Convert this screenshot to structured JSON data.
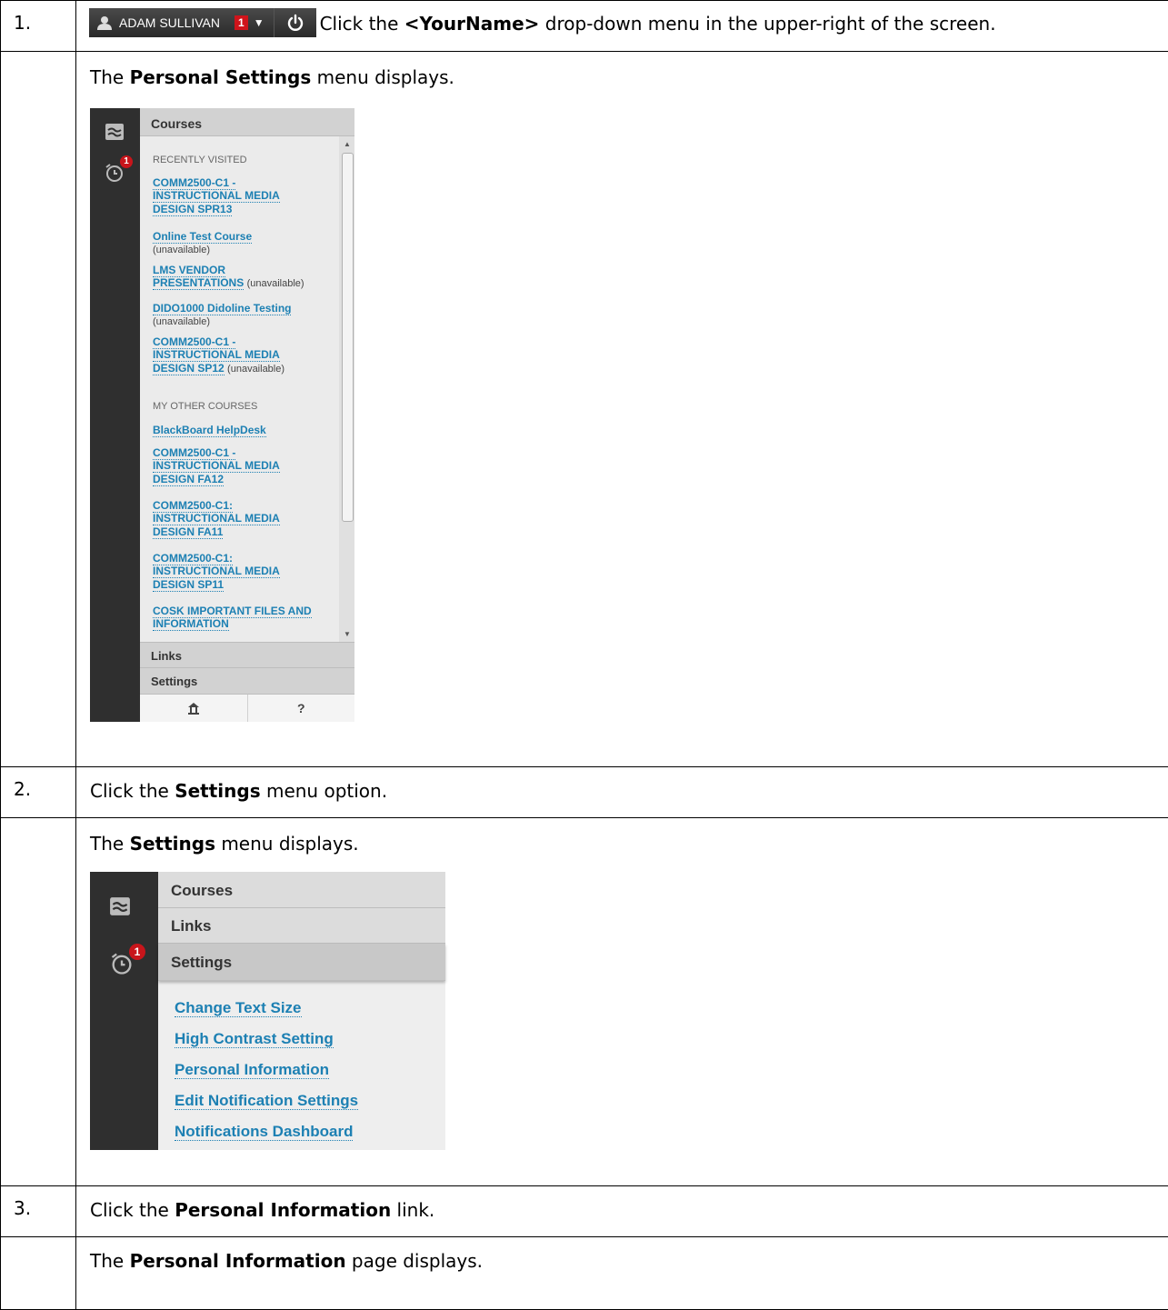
{
  "steps": [
    {
      "number": "1.",
      "instruction_pre": "Click the ",
      "instruction_bold": "<YourName>",
      "instruction_post": " drop-down menu in the upper-right of the screen.",
      "user_bar": {
        "user_name": "ADAM SULLIVAN",
        "notification_count": "1",
        "user_icon": "user-icon",
        "caret_icon": "caret-down-icon",
        "power_icon": "power-icon"
      }
    },
    {
      "result_pre": "The ",
      "result_bold": "Personal Settings",
      "result_post": " menu displays."
    },
    {
      "number": "2.",
      "instruction_pre": "Click the ",
      "instruction_bold": "Settings",
      "instruction_post": " menu option."
    },
    {
      "result_pre": "The ",
      "result_bold": "Settings",
      "result_post": " menu displays."
    },
    {
      "number": "3.",
      "instruction_pre": "Click the ",
      "instruction_bold": "Personal Information",
      "instruction_post": " link."
    },
    {
      "result_pre": "The ",
      "result_bold": "Personal Information",
      "result_post": " page displays."
    }
  ],
  "personal_settings_menu": {
    "alarm_badge": "1",
    "courses_header": "Courses",
    "recently_visited_label": "RECENTLY VISITED",
    "recent_courses": [
      {
        "lines": [
          "COMM2500-C1 -",
          "INSTRUCTIONAL MEDIA",
          "DESIGN SPR13"
        ],
        "status": ""
      },
      {
        "lines": [
          "Online Test Course"
        ],
        "status": "(unavailable)"
      },
      {
        "lines": [
          "LMS VENDOR",
          "PRESENTATIONS"
        ],
        "status": "(unavailable)"
      },
      {
        "lines": [
          "DIDO1000 Didoline Testing"
        ],
        "status": "(unavailable)"
      },
      {
        "lines": [
          "COMM2500-C1 -",
          "INSTRUCTIONAL MEDIA",
          "DESIGN SP12"
        ],
        "status": "(unavailable)"
      }
    ],
    "other_courses_label": "MY OTHER COURSES",
    "other_courses": [
      {
        "lines": [
          "BlackBoard HelpDesk"
        ]
      },
      {
        "lines": [
          "COMM2500-C1 -",
          "INSTRUCTIONAL MEDIA",
          "DESIGN FA12"
        ]
      },
      {
        "lines": [
          "COMM2500-C1:",
          "INSTRUCTIONAL MEDIA",
          "DESIGN FA11"
        ]
      },
      {
        "lines": [
          "COMM2500-C1:",
          "INSTRUCTIONAL MEDIA",
          "DESIGN SP11"
        ]
      },
      {
        "lines": [
          "COSK IMPORTANT FILES AND",
          "INFORMATION"
        ]
      }
    ],
    "links_header": "Links",
    "settings_header": "Settings",
    "home_icon": "home-icon",
    "help_label": "?"
  },
  "settings_menu": {
    "alarm_badge": "1",
    "courses_header": "Courses",
    "links_header": "Links",
    "settings_header": "Settings",
    "items": [
      "Change Text Size",
      "High Contrast Setting",
      "Personal Information",
      "Edit Notification Settings",
      "Notifications Dashboard"
    ]
  }
}
